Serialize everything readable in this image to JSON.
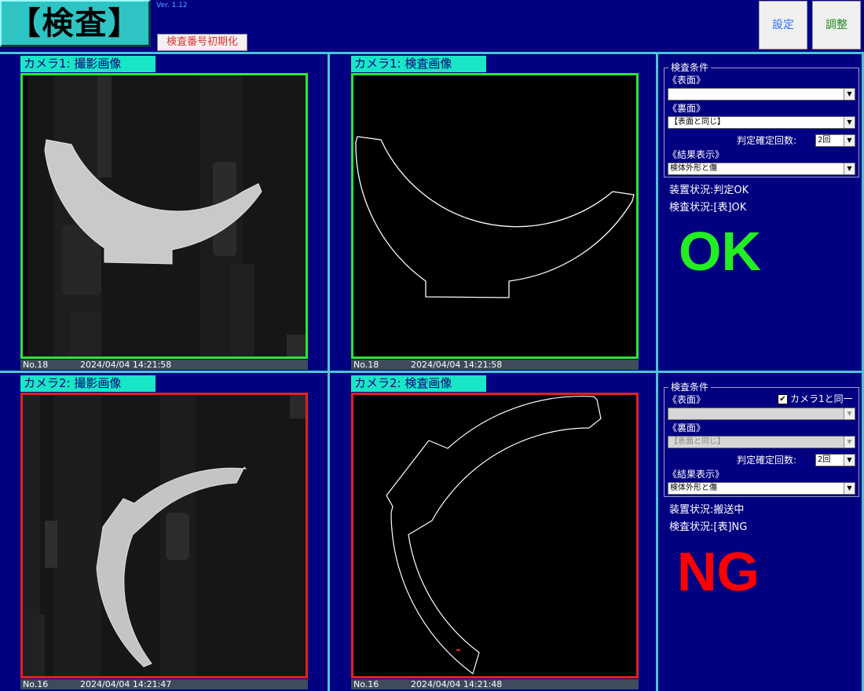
{
  "header": {
    "title": "【検査】",
    "version": "Ver. 1.12",
    "reset_button": "検査番号初期化",
    "settings_button": "設定",
    "adjust_button": "調整"
  },
  "panels": [
    {
      "tab": "カメラ1: 撮影画像",
      "no": "No.18",
      "timestamp": "2024/04/04 14:21:58",
      "border_color": "#2ce82c"
    },
    {
      "tab": "カメラ1: 検査画像",
      "no": "No.18",
      "timestamp": "2024/04/04 14:21:58",
      "border_color": "#2ce82c"
    },
    {
      "tab": "カメラ2: 撮影画像",
      "no": "No.16",
      "timestamp": "2024/04/04 14:21:47",
      "border_color": "#e62020"
    },
    {
      "tab": "カメラ2: 検査画像",
      "no": "No.16",
      "timestamp": "2024/04/04 14:21:48",
      "border_color": "#e62020"
    }
  ],
  "camera1_settings": {
    "group_title": "検査条件",
    "front_label": "《表面》",
    "front_value": "",
    "back_label": "《裏面》",
    "back_value": "【表面と同じ】",
    "count_label": "判定確定回数:",
    "count_value": "2回",
    "display_label": "《結果表示》",
    "display_value": "検体外形と傷",
    "device_status": "装置状況:判定OK",
    "inspection_status": "検査状況:[表]OK",
    "result": "OK",
    "result_color": "#22ee22"
  },
  "camera2_settings": {
    "group_title": "検査条件",
    "same_as_cam1_label": "カメラ1と同一",
    "same_as_cam1_checked": "✔",
    "front_label": "《表面》",
    "front_value": "",
    "back_label": "《裏面》",
    "back_value": "【表面と同じ】",
    "count_label": "判定確定回数:",
    "count_value": "2回",
    "display_label": "《結果表示》",
    "display_value": "検体外形と傷",
    "device_status": "装置状況:搬送中",
    "inspection_status": "検査状況:[表]NG",
    "result": "NG",
    "result_color": "#ff0000"
  },
  "colors": {
    "background": "#000080",
    "grid": "#4fc3d9",
    "tab": "#19e6c7",
    "ok": "#2ce82c",
    "ng": "#e62020"
  }
}
